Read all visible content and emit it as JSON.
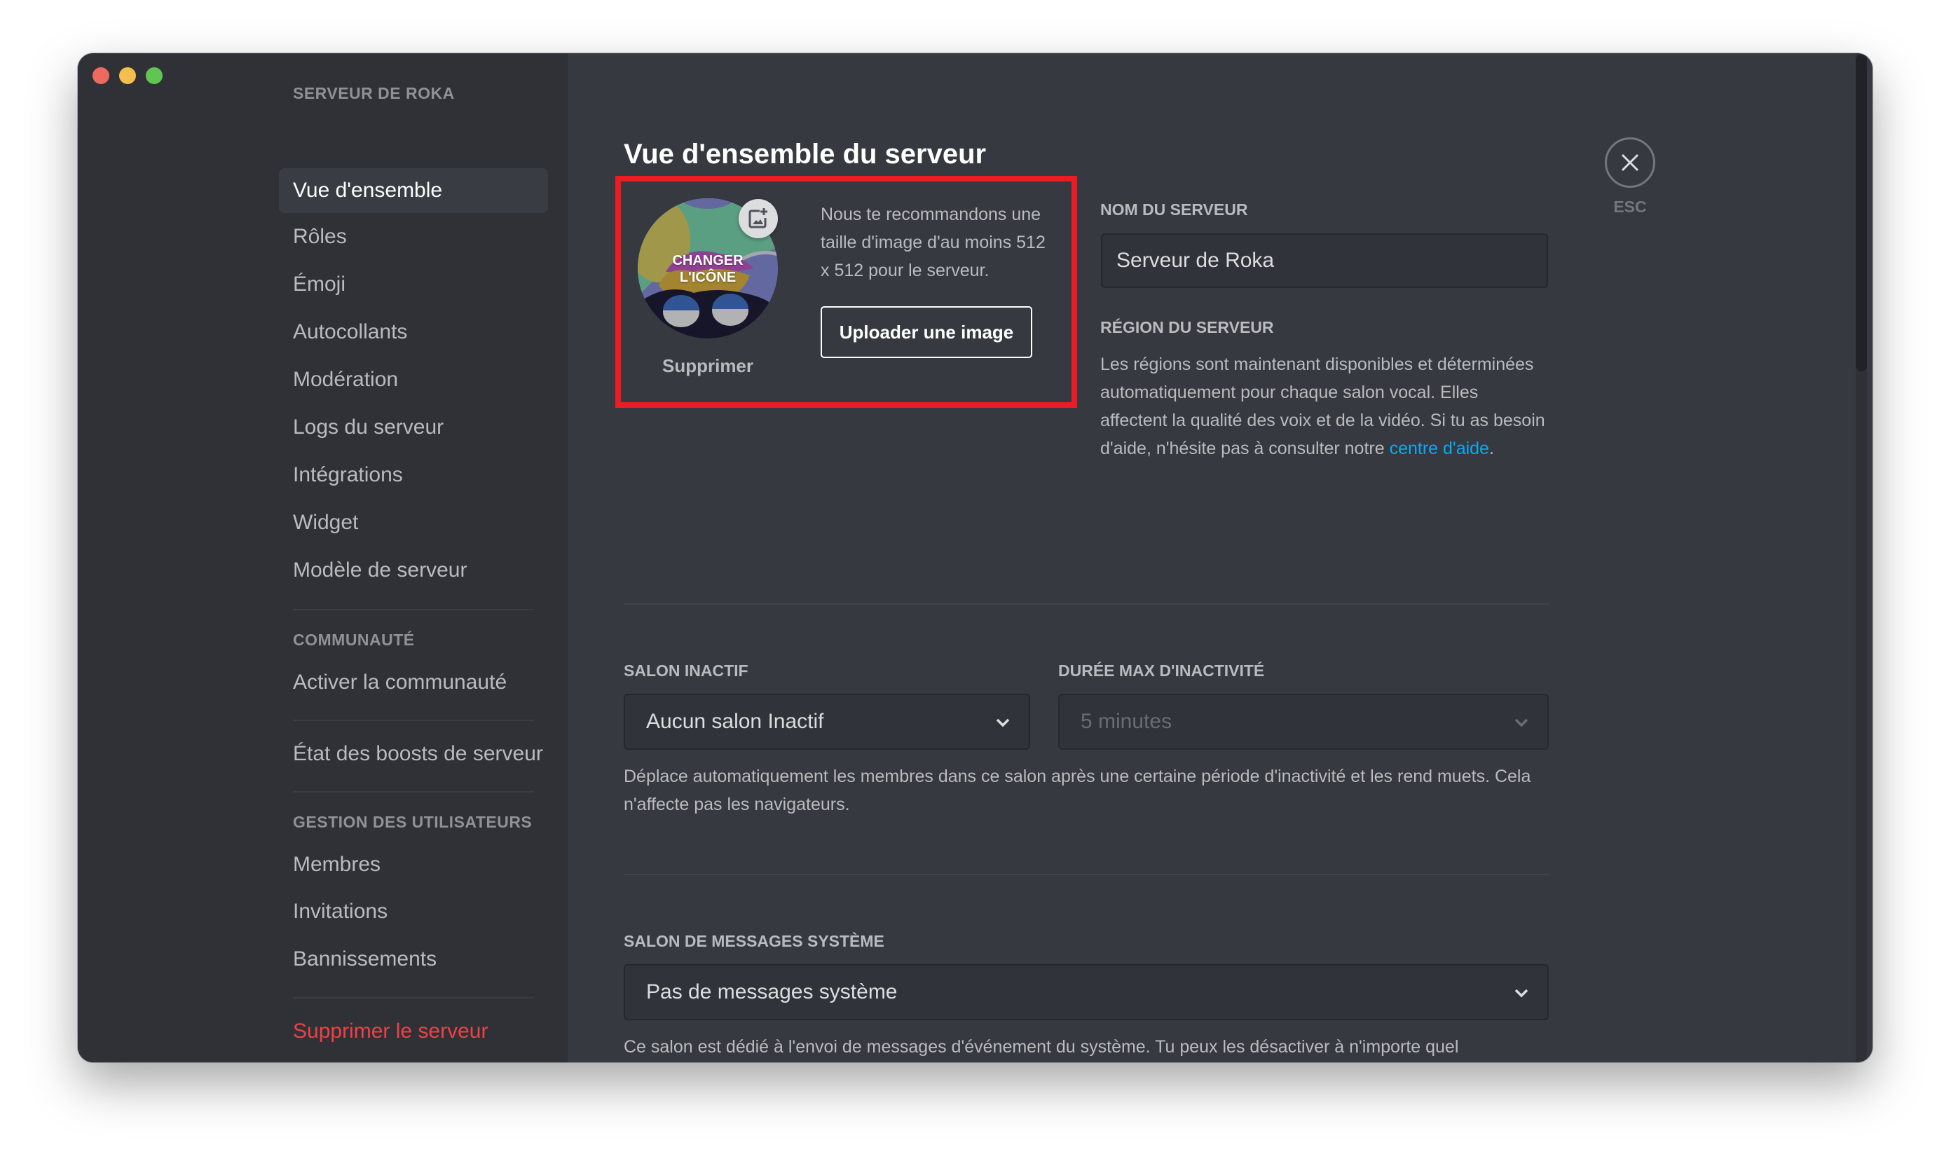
{
  "window": {
    "controls": [
      "close",
      "minimize",
      "zoom"
    ]
  },
  "sidebar": {
    "sections": [
      {
        "header": "SERVEUR DE ROKA",
        "items": [
          {
            "label": "Vue d'ensemble",
            "selected": true
          },
          {
            "label": "Rôles"
          },
          {
            "label": "Émoji"
          },
          {
            "label": "Autocollants"
          },
          {
            "label": "Modération"
          },
          {
            "label": "Logs du serveur"
          },
          {
            "label": "Intégrations"
          },
          {
            "label": "Widget"
          },
          {
            "label": "Modèle de serveur"
          }
        ]
      },
      {
        "header": "COMMUNAUTÉ",
        "items": [
          {
            "label": "Activer la communauté"
          }
        ]
      },
      {
        "header": "",
        "items": [
          {
            "label": "État des boosts de serveur"
          }
        ]
      },
      {
        "header": "GESTION DES UTILISATEURS",
        "items": [
          {
            "label": "Membres"
          },
          {
            "label": "Invitations"
          },
          {
            "label": "Bannissements"
          }
        ]
      }
    ],
    "danger_item": {
      "label": "Supprimer le serveur",
      "color": "#ed4245"
    }
  },
  "main": {
    "title": "Vue d'ensemble du serveur",
    "icon_section": {
      "icon_overlay_line1": "CHANGER",
      "icon_overlay_line2": "L'ICÔNE",
      "add_image_icon": "image-plus-icon",
      "remove_label": "Supprimer",
      "recommendation": "Nous te recommandons une taille d'image d'au moins 512 x 512 pour le serveur.",
      "upload_button": "Uploader une image",
      "highlight_color": "#ed1c24"
    },
    "server_name": {
      "label": "NOM DU SERVEUR",
      "value": "Serveur de Roka"
    },
    "server_region": {
      "label": "RÉGION DU SERVEUR",
      "text": "Les régions sont maintenant disponibles et déterminées automatiquement pour chaque salon vocal. Elles affectent la qualité des voix et de la vidéo. Si tu as besoin d'aide, n'hésite pas à consulter notre ",
      "link_text": "centre d'aide",
      "text_end": "."
    },
    "inactive_channel": {
      "label": "SALON INACTIF",
      "value": "Aucun salon Inactif"
    },
    "inactive_timeout": {
      "label": "DURÉE MAX D'INACTIVITÉ",
      "value": "5 minutes",
      "disabled": true
    },
    "inactive_description": "Déplace automatiquement les membres dans ce salon après une certaine période d'inactivité et les rend muets. Cela n'affecte pas les navigateurs.",
    "system_channel": {
      "label": "SALON DE MESSAGES SYSTÈME",
      "value": "Pas de messages système",
      "description": "Ce salon est dédié à l'envoi de messages d'événement du système. Tu peux les désactiver à n'importe quel"
    },
    "close": {
      "icon": "close-icon",
      "label": "ESC"
    }
  },
  "colors": {
    "sidebar_bg": "#2f3136",
    "content_bg": "#36393f",
    "link": "#00aff4",
    "danger": "#ed4245"
  }
}
